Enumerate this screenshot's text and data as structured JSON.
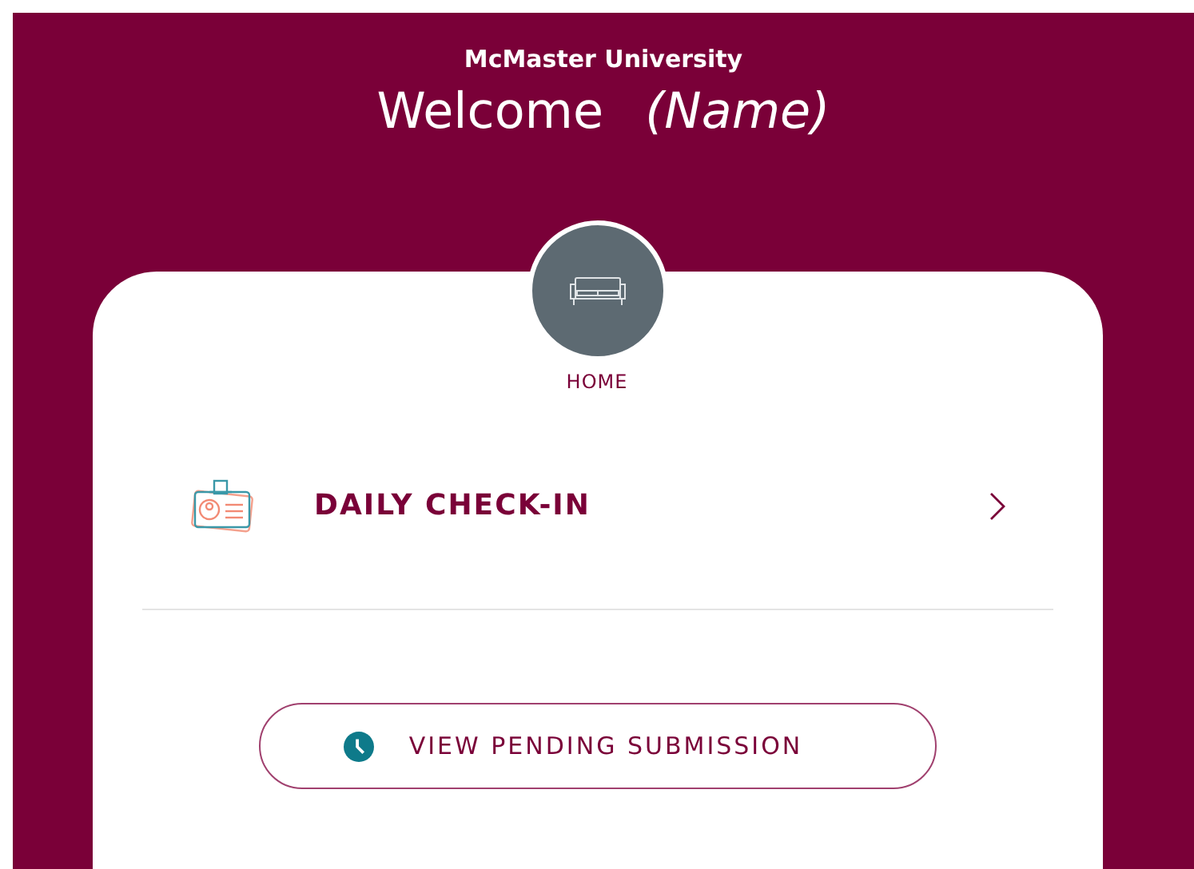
{
  "header": {
    "organization": "McMaster University",
    "greeting": "Welcome",
    "name": "(Name)"
  },
  "location": {
    "label": "HOME"
  },
  "menu_items": [
    {
      "label": "DAILY CHECK-IN"
    }
  ],
  "action_button": {
    "label": "VIEW PENDING SUBMISSION"
  }
}
